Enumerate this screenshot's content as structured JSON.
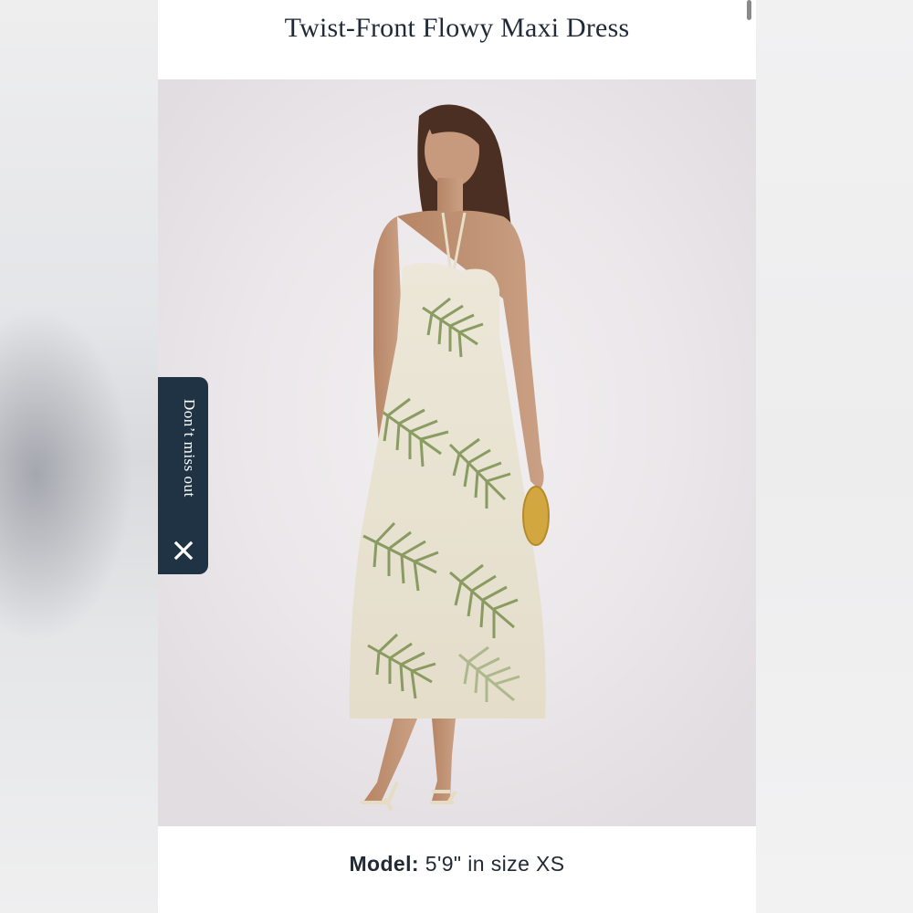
{
  "product": {
    "title": "Twist-Front Flowy Maxi Dress"
  },
  "promo_tab": {
    "label": "Don’t miss out",
    "close_icon": "close-icon"
  },
  "model_info": {
    "label": "Model:",
    "value": "5'9\" in size XS"
  },
  "colors": {
    "promo_tab_bg": "#1f3345",
    "title_text": "#1f2a38",
    "dress_print": "#8a9a5e"
  }
}
